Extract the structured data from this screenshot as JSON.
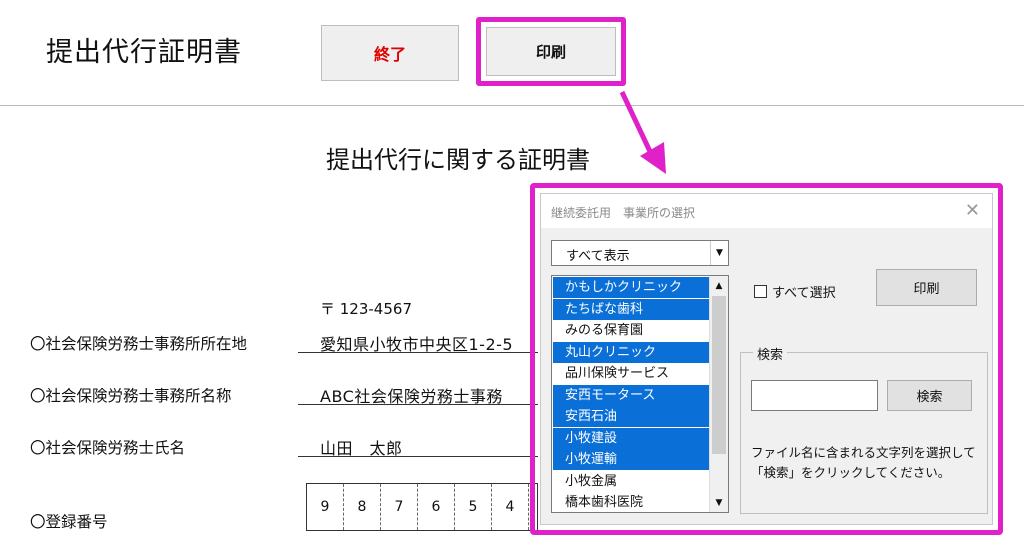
{
  "sheet": {
    "title": "提出代行証明書",
    "end_button": "終了",
    "print_button": "印刷",
    "doc_heading": "提出代行に関する証明書",
    "postal": "〒 123-4567",
    "rows": [
      {
        "label": "〇社会保険労務士事務所所在地",
        "value": "愛知県小牧市中央区1-2-5"
      },
      {
        "label": "〇社会保険労務士事務所名称",
        "value": "ABC社会保険労務士事務"
      },
      {
        "label": "〇社会保険労務士氏名",
        "value": "山田　太郎"
      },
      {
        "label": "〇登録番号",
        "value": ""
      }
    ],
    "registration_digits": [
      "9",
      "8",
      "7",
      "6",
      "5",
      "4"
    ]
  },
  "dialog": {
    "title": "継続委託用　事業所の選択",
    "close_glyph": "✕",
    "filter_value": "すべて表示",
    "list_items": [
      {
        "label": "かもしかクリニック",
        "selected": true
      },
      {
        "label": "たちばな歯科",
        "selected": true
      },
      {
        "label": "みのる保育園",
        "selected": false
      },
      {
        "label": "丸山クリニック",
        "selected": true
      },
      {
        "label": "品川保険サービス",
        "selected": false
      },
      {
        "label": "安西モータース",
        "selected": true
      },
      {
        "label": "安西石油",
        "selected": true
      },
      {
        "label": "小牧建設",
        "selected": true
      },
      {
        "label": "小牧運輸",
        "selected": true
      },
      {
        "label": "小牧金属",
        "selected": false
      },
      {
        "label": "橋本歯科医院",
        "selected": false
      }
    ],
    "select_all_label": "すべて選択",
    "print_button": "印刷",
    "search_group_label": "検索",
    "search_value": "",
    "search_button": "検索",
    "help_text": "ファイル名に含まれる文字列を選択して「検索」をクリックしてください。"
  },
  "colors": {
    "highlight": "#e020c8",
    "selection": "#0a6fd6",
    "end_text": "#e00000"
  }
}
